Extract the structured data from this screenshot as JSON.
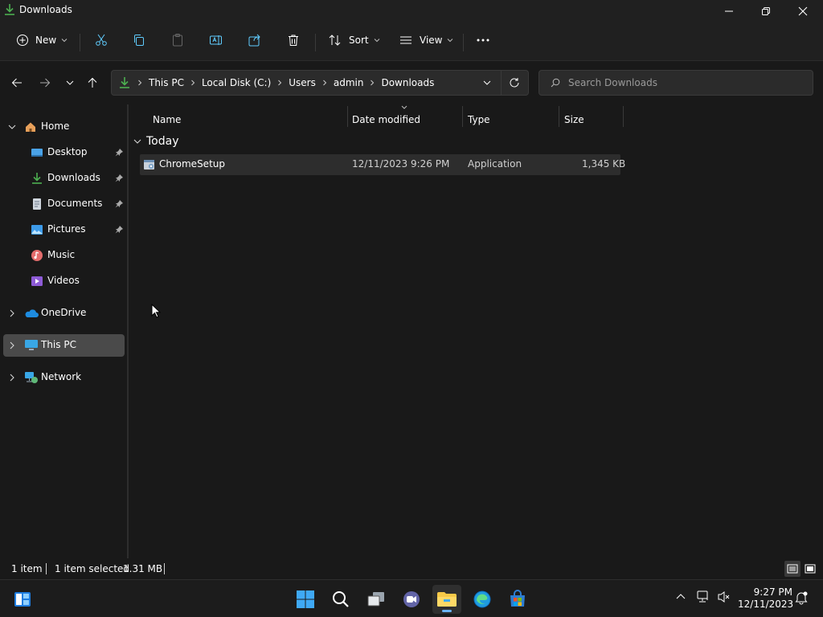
{
  "window": {
    "title": "Downloads"
  },
  "toolbar": {
    "new_label": "New",
    "sort_label": "Sort",
    "view_label": "View"
  },
  "address": {
    "crumbs": [
      "This PC",
      "Local Disk (C:)",
      "Users",
      "admin",
      "Downloads"
    ]
  },
  "search": {
    "placeholder": "Search Downloads"
  },
  "sidebar": {
    "items": [
      {
        "label": "Home",
        "icon": "home-icon"
      },
      {
        "label": "Desktop",
        "icon": "desktop-icon",
        "pinned": true
      },
      {
        "label": "Downloads",
        "icon": "download-icon",
        "pinned": true
      },
      {
        "label": "Documents",
        "icon": "document-icon",
        "pinned": true
      },
      {
        "label": "Pictures",
        "icon": "pictures-icon",
        "pinned": true
      },
      {
        "label": "Music",
        "icon": "music-icon"
      },
      {
        "label": "Videos",
        "icon": "videos-icon"
      },
      {
        "label": "OneDrive",
        "icon": "onedrive-icon"
      },
      {
        "label": "This PC",
        "icon": "pc-icon",
        "selected": true
      },
      {
        "label": "Network",
        "icon": "network-icon"
      }
    ]
  },
  "columns": {
    "name": "Name",
    "date": "Date modified",
    "type": "Type",
    "size": "Size"
  },
  "group": {
    "label": "Today"
  },
  "files": [
    {
      "name": "ChromeSetup",
      "date": "12/11/2023 9:26 PM",
      "type": "Application",
      "size": "1,345 KB"
    }
  ],
  "status": {
    "count": "1 item",
    "selected": "1 item selected",
    "size": "1.31 MB"
  },
  "taskbar": {
    "time": "9:27 PM",
    "date": "12/11/2023"
  },
  "colors": {
    "accent": "#60cdff",
    "folder": "#f7c948",
    "download_green": "#4caf50"
  }
}
